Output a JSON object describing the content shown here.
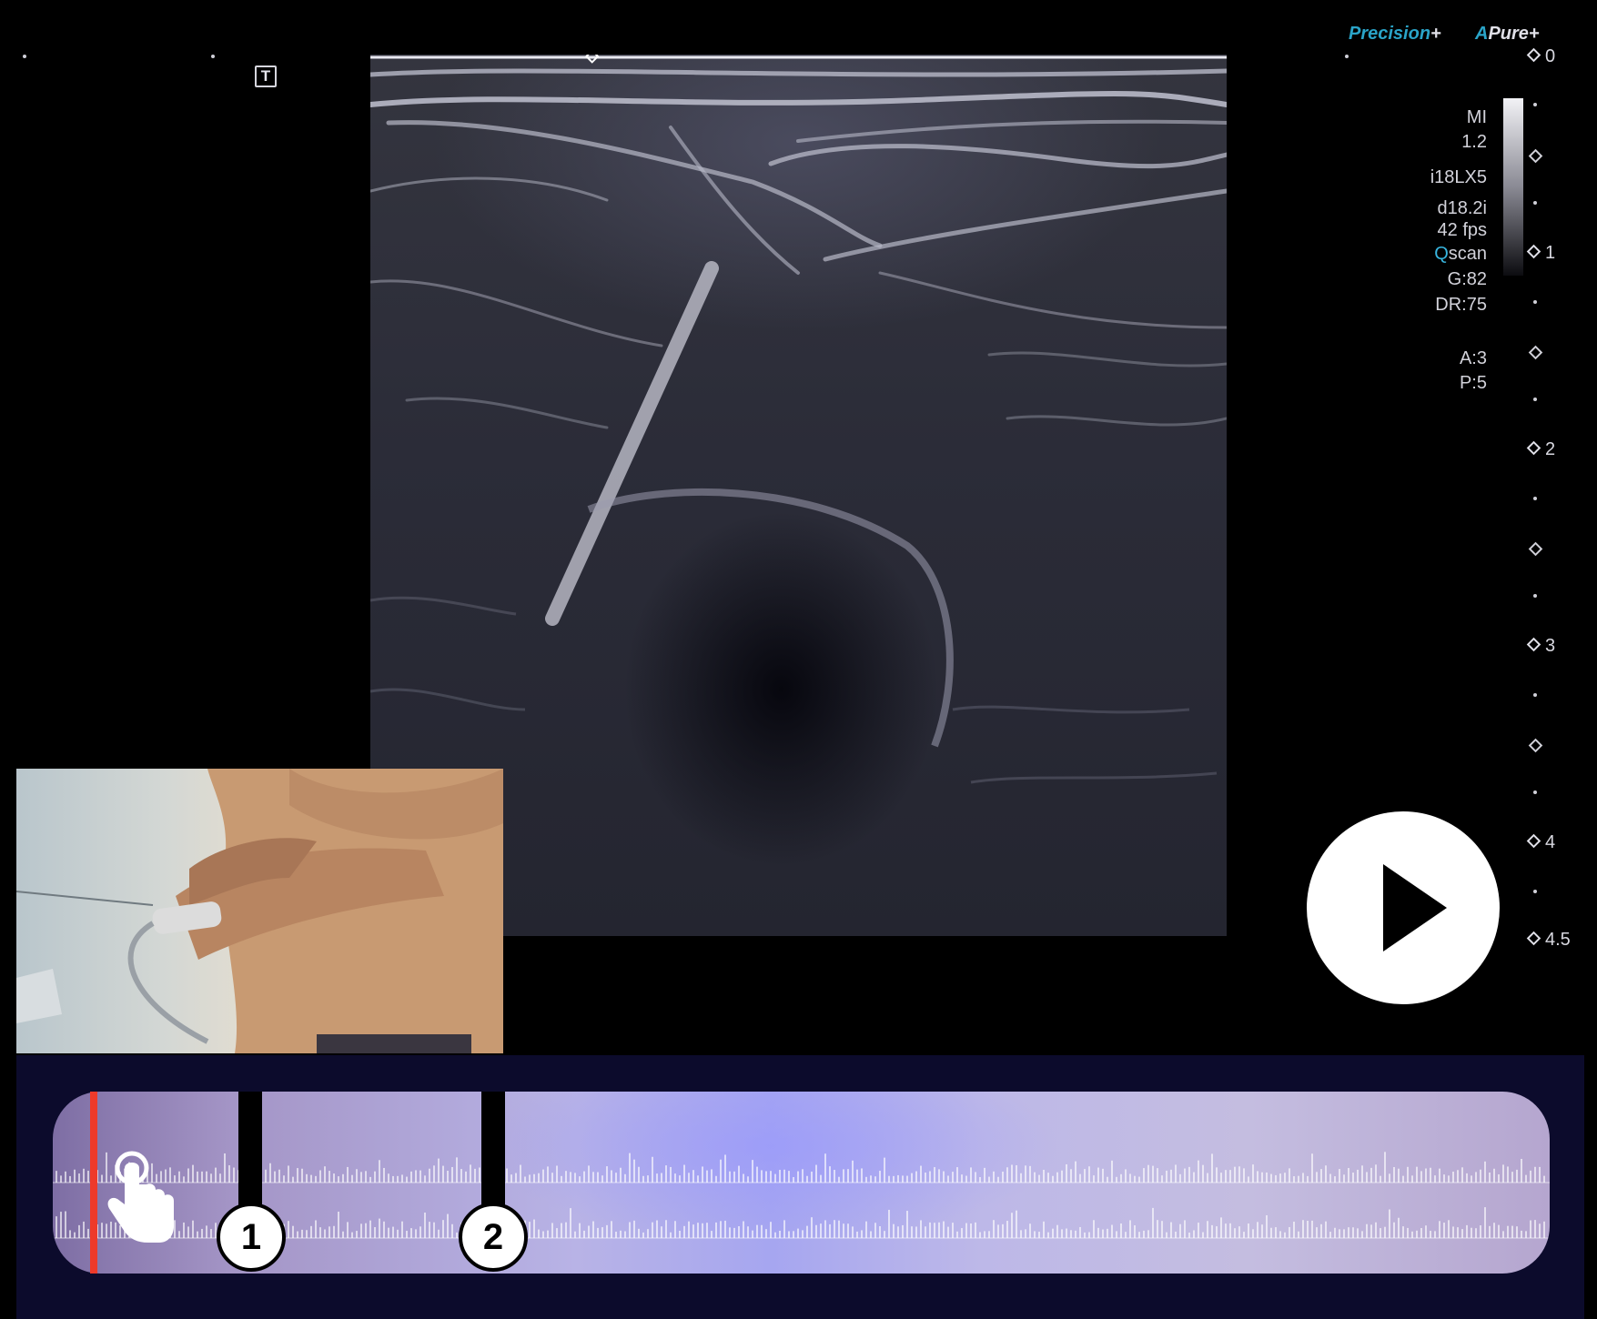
{
  "overlay": {
    "t_marker": "T"
  },
  "brand": {
    "precision": "Precision",
    "pure": "Pure",
    "a_mark": "A",
    "plus": "+"
  },
  "params": {
    "mi_label": "MI",
    "mi_value": "1.2",
    "probe": "i18LX5",
    "depth_code": "d18.2i",
    "frame_rate": "42 fps",
    "qscan_q": "Q",
    "qscan_rest": "scan",
    "gain": "G:82",
    "dynamic_range": "DR:75",
    "a_setting": "A:3",
    "p_setting": "P:5"
  },
  "depth_scale": [
    "0",
    "1",
    "2",
    "3",
    "4",
    "4.5"
  ],
  "timeline": {
    "markers": [
      "1",
      "2"
    ]
  },
  "icons": {
    "play": "play-icon",
    "hand": "hand-pointer-icon",
    "text_marker": "t-icon"
  },
  "colors": {
    "playhead": "#ee3a2a",
    "timeline_background": "#0c0b2c",
    "brand_cyan": "#2aa4c8"
  }
}
